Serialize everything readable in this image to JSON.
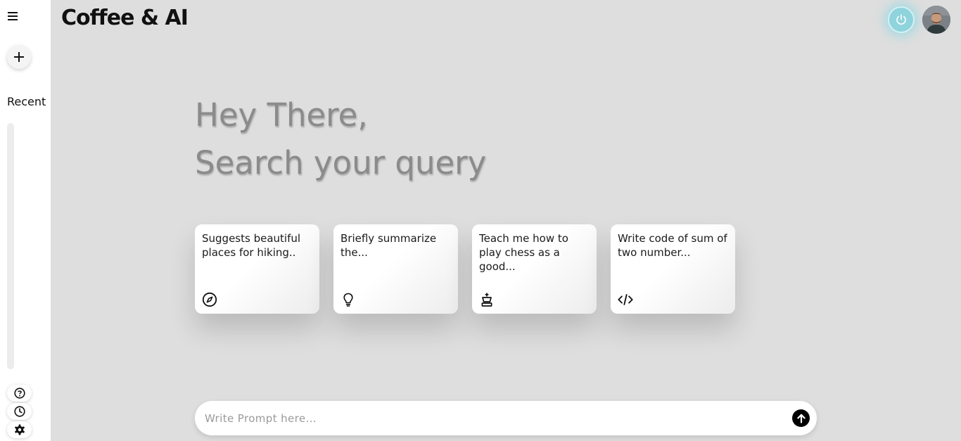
{
  "app": {
    "title": "Coffee & AI"
  },
  "sidebar": {
    "menu_icon": "hamburger-menu-icon",
    "new_chat_icon": "plus-icon",
    "recent_label": "Recent",
    "bottom": [
      {
        "name": "help",
        "icon": "question-icon"
      },
      {
        "name": "activity",
        "icon": "clock-icon"
      },
      {
        "name": "settings",
        "icon": "gear-icon"
      }
    ]
  },
  "header": {
    "power_icon": "power-icon",
    "avatar": "user-avatar",
    "accent": "#8fd3dc"
  },
  "greeting": {
    "line1": "Hey There,",
    "line2": "Search your query"
  },
  "cards": [
    {
      "text": "Suggests beautiful places for hiking..",
      "icon": "compass-icon"
    },
    {
      "text": "Briefly summarize the...",
      "icon": "lightbulb-icon"
    },
    {
      "text": "Teach me how to play chess as a good...",
      "icon": "chess-king-icon"
    },
    {
      "text": "Write code of sum of two number...",
      "icon": "code-icon"
    }
  ],
  "prompt": {
    "placeholder": "Write Prompt here...",
    "value": "",
    "send_icon": "arrow-up-icon"
  },
  "colors": {
    "background": "#dedede",
    "sidebar": "#ffffff",
    "greeting_text": "#8b8b8b"
  }
}
